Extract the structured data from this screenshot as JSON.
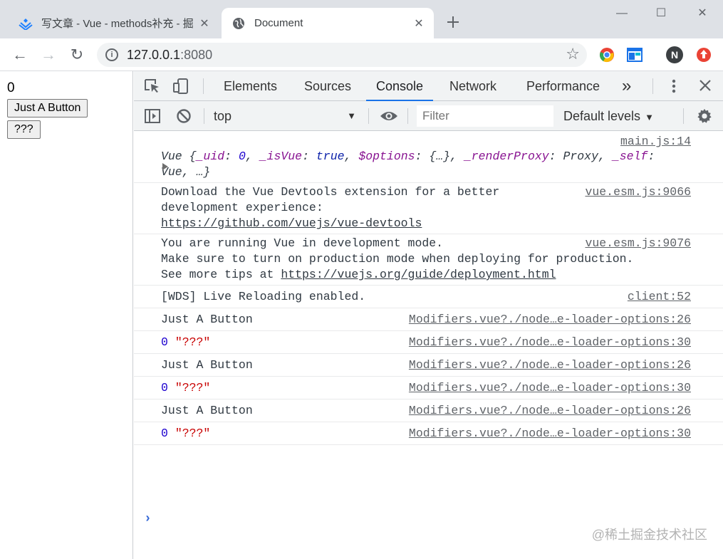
{
  "browser": {
    "tabs": [
      {
        "title": "写文章 - Vue - methods补充 - 掘",
        "active": false
      },
      {
        "title": "Document",
        "active": true
      }
    ],
    "new_tab_icon": "plus-icon",
    "window_controls": {
      "minimize": "—",
      "maximize": "☐",
      "close": "✕"
    },
    "nav": {
      "back": "←",
      "forward": "→",
      "reload": "↻"
    },
    "url": {
      "host": "127.0.0.1",
      "port": ":8080"
    },
    "profile_initial": "N"
  },
  "page": {
    "counter": "0",
    "button1": "Just A Button",
    "button2": "???"
  },
  "devtools": {
    "tabs": [
      "Elements",
      "Sources",
      "Console",
      "Network",
      "Performance"
    ],
    "active_tab": "Console",
    "more_tabs": "»",
    "context": "top",
    "filter_placeholder": "Filter",
    "levels": "Default levels"
  },
  "console": {
    "object_msg": {
      "source": "main.js:14",
      "line1_parts": [
        "Vue {",
        "_uid",
        ": ",
        "0",
        ", ",
        "_isVue",
        ": ",
        "true",
        ", ",
        "$options",
        ": {…}, ",
        "_renderProxy",
        ": Proxy, ",
        "_self",
        ":"
      ],
      "line2": "Vue, …}"
    },
    "devtools_msg": {
      "source": "vue.esm.js:9066",
      "text": "Download the Vue Devtools extension for a better\ndevelopment experience:\n",
      "link": "https://github.com/vuejs/vue-devtools"
    },
    "devmode_msg": {
      "source": "vue.esm.js:9076",
      "text": "You are running Vue in development mode.\nMake sure to turn on production mode when deploying for production.\nSee more tips at ",
      "link": "https://vuejs.org/guide/deployment.html"
    },
    "wds_msg": {
      "source": "client:52",
      "text": "[WDS] Live Reloading enabled."
    },
    "log_rows": [
      {
        "kind": "text",
        "text": "Just A Button",
        "source": "Modifiers.vue?./node…e-loader-options:26"
      },
      {
        "kind": "pair",
        "num": "0",
        "str": "\"???\"",
        "source": "Modifiers.vue?./node…e-loader-options:30"
      },
      {
        "kind": "text",
        "text": "Just A Button",
        "source": "Modifiers.vue?./node…e-loader-options:26"
      },
      {
        "kind": "pair",
        "num": "0",
        "str": "\"???\"",
        "source": "Modifiers.vue?./node…e-loader-options:30"
      },
      {
        "kind": "text",
        "text": "Just A Button",
        "source": "Modifiers.vue?./node…e-loader-options:26"
      },
      {
        "kind": "pair",
        "num": "0",
        "str": "\"???\"",
        "source": "Modifiers.vue?./node…e-loader-options:30"
      }
    ],
    "prompt": "›"
  },
  "watermark": "@稀土掘金技术社区",
  "colors": {
    "accent": "#1a73e8",
    "tab_strip": "#dee1e6",
    "devtools_bar": "#f1f3f4"
  }
}
